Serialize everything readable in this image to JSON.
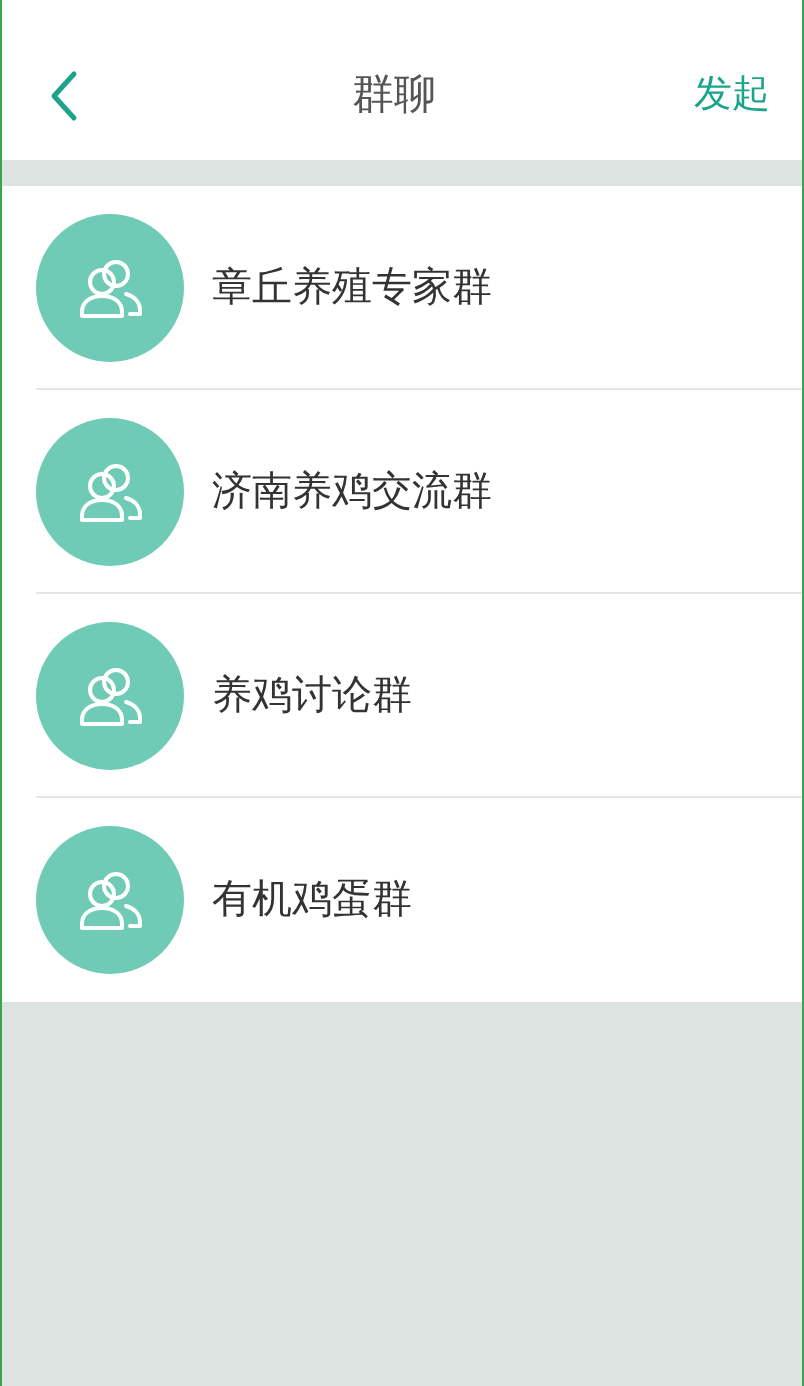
{
  "header": {
    "title": "群聊",
    "action": "发起"
  },
  "groups": [
    {
      "name": "章丘养殖专家群"
    },
    {
      "name": "济南养鸡交流群"
    },
    {
      "name": "养鸡讨论群"
    },
    {
      "name": "有机鸡蛋群"
    }
  ]
}
